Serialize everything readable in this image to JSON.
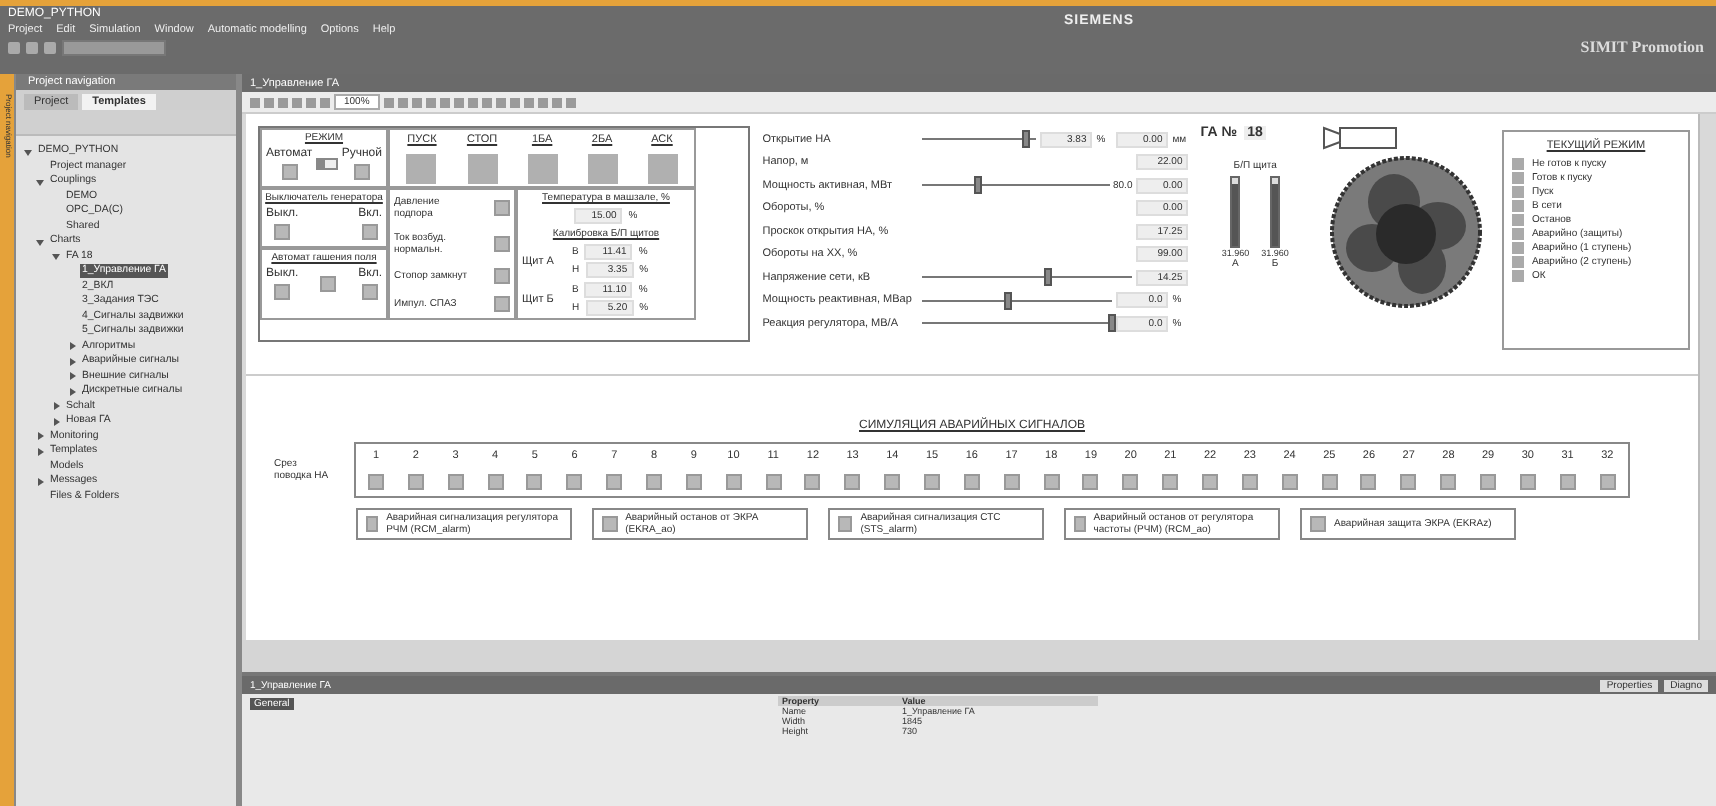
{
  "window": {
    "title": "DEMO_PYTHON",
    "brand": "SIEMENS",
    "product": "SIMIT Promotion"
  },
  "menu": [
    "Project",
    "Edit",
    "Simulation",
    "Window",
    "Automatic modelling",
    "Options",
    "Help"
  ],
  "navigator": {
    "title": "Project navigation",
    "side_label": "Project navigation",
    "tabs": [
      {
        "label": "Project",
        "selected": false
      },
      {
        "label": "Templates",
        "selected": true
      }
    ],
    "tree": [
      {
        "label": "DEMO_PYTHON",
        "selected": false,
        "expanded": true,
        "children": [
          {
            "label": "Project manager",
            "selected": false
          },
          {
            "label": "Couplings",
            "selected": false,
            "expanded": true,
            "children": [
              {
                "label": "DEMO",
                "selected": false
              },
              {
                "label": "OPC_DA(C)",
                "selected": false
              },
              {
                "label": "Shared",
                "selected": false
              }
            ]
          },
          {
            "label": "Charts",
            "selected": false,
            "expanded": true,
            "children": [
              {
                "label": "FA 18",
                "selected": false,
                "expanded": true,
                "children": [
                  {
                    "label": "1_Управление ГА",
                    "selected": true
                  },
                  {
                    "label": "2_ВКЛ",
                    "selected": false
                  },
                  {
                    "label": "3_Задания ТЭС",
                    "selected": false
                  },
                  {
                    "label": "4_Сигналы задвижки",
                    "selected": false
                  },
                  {
                    "label": "5_Сигналы задвижки",
                    "selected": false
                  },
                  {
                    "label": "Алгоритмы",
                    "selected": false,
                    "expanded": false
                  },
                  {
                    "label": "Аварийные сигналы",
                    "selected": false,
                    "expanded": false
                  },
                  {
                    "label": "Внешние сигналы",
                    "selected": false,
                    "expanded": false
                  },
                  {
                    "label": "Дискретные сигналы",
                    "selected": false,
                    "expanded": false
                  }
                ]
              },
              {
                "label": "Schalt",
                "selected": false,
                "expanded": false
              },
              {
                "label": "Новая ГА",
                "selected": false,
                "expanded": false
              }
            ]
          },
          {
            "label": "Monitoring",
            "selected": false,
            "expanded": false
          },
          {
            "label": "Templates",
            "selected": false,
            "expanded": false
          },
          {
            "label": "Models",
            "selected": false
          },
          {
            "label": "Messages",
            "selected": false,
            "expanded": false
          },
          {
            "label": "Files & Folders",
            "selected": false
          }
        ]
      }
    ]
  },
  "editor": {
    "tab": "1_Управление ГА",
    "zoom": "100%"
  },
  "mode": {
    "title": "РЕЖИМ",
    "auto": "Автомат",
    "manual": "Ручной",
    "switch_on": false
  },
  "commands": [
    "ПУСК",
    "СТОП",
    "1БА",
    "2БА",
    "АСК"
  ],
  "breaker": {
    "title": "Выключатель генератора",
    "off": "Выкл.",
    "on": "Вкл."
  },
  "field_breaker": {
    "title": "Автомат гашения поля",
    "off": "Выкл.",
    "on": "Вкл."
  },
  "signals": [
    "Давление подпора",
    "Ток возбуд. нормальн.",
    "Стопор замкнут",
    "Импул. СПАЗ"
  ],
  "temperature": {
    "title": "Температура в машзале, %",
    "value": "15.00",
    "unit": "%"
  },
  "calibration": {
    "title": "Калибровка Б/П щитов",
    "shields": [
      {
        "name": "Щит А",
        "rows": [
          {
            "label": "В",
            "value": "11.41",
            "unit": "%"
          },
          {
            "label": "Н",
            "value": "3.35",
            "unit": "%"
          }
        ]
      },
      {
        "name": "Щит Б",
        "rows": [
          {
            "label": "В",
            "value": "11.10",
            "unit": "%"
          },
          {
            "label": "Н",
            "value": "5.20",
            "unit": "%"
          }
        ]
      }
    ]
  },
  "parameters": [
    {
      "label": "Открытие НА",
      "kind": "slider",
      "level": 0.9,
      "value": "3.83",
      "unit": "%",
      "extra_value": "0.00",
      "extra_unit": "мм"
    },
    {
      "label": "Напор, м",
      "kind": "field",
      "value": "22.00"
    },
    {
      "label": "Мощность активная, МВт",
      "kind": "slider",
      "level": 0.3,
      "reading": "80.0",
      "value": "0.00"
    },
    {
      "label": "Обороты, %",
      "kind": "field",
      "value": "0.00"
    },
    {
      "label": "Проскок открытия НА, %",
      "kind": "field",
      "value": "17.25"
    },
    {
      "label": "Обороты на ХХ, %",
      "kind": "field",
      "value": "99.00"
    },
    {
      "label": "Напряжение сети, кВ",
      "kind": "slider",
      "level": 0.6,
      "value": "14.25"
    },
    {
      "label": "Мощность реактивная, МВар",
      "kind": "slider",
      "level": 0.45,
      "value": "0.0",
      "unit": "%"
    },
    {
      "label": "Реакция регулятора, МВ/А",
      "kind": "slider",
      "level": 1.0,
      "value": "0.0",
      "unit": "%"
    }
  ],
  "unit": {
    "label": "ГА №",
    "number": "18",
    "bars_title": "Б/П щита",
    "bars": [
      {
        "value": "31.960",
        "name": "А",
        "level": 0.9
      },
      {
        "value": "31.960",
        "name": "Б",
        "level": 0.9
      }
    ]
  },
  "status": {
    "title": "ТЕКУЩИЙ РЕЖИМ",
    "items": [
      "Не готов к пуску",
      "Готов к пуску",
      "Пуск",
      "В сети",
      "Останов",
      "Аварийно (защиты)",
      "Аварийно (1 ступень)",
      "Аварийно (2 ступень)",
      "ОК"
    ]
  },
  "alarms": {
    "title": "СИМУЛЯЦИЯ АВАРИЙНЫХ СИГНАЛОВ",
    "row_label": "Срез поводка НА",
    "numbers": [
      "1",
      "2",
      "3",
      "4",
      "5",
      "6",
      "7",
      "8",
      "9",
      "10",
      "11",
      "12",
      "13",
      "14",
      "15",
      "16",
      "17",
      "18",
      "19",
      "20",
      "21",
      "22",
      "23",
      "24",
      "25",
      "26",
      "27",
      "28",
      "29",
      "30",
      "31",
      "32"
    ],
    "buttons": [
      "Аварийная сигнализация регулятора РЧМ (RCM_alarm)",
      "Аварийный останов от ЭКРА (EKRA_ao)",
      "Аварийная сигнализация СТС (STS_alarm)",
      "Аварийный останов от регулятора частоты (РЧМ) (RCM_ao)",
      "Аварийная защита ЭКРА (EKRAz)"
    ]
  },
  "properties_panel": {
    "title": "1_Управление ГА",
    "tabs": [
      "Properties",
      "Diagno"
    ],
    "section": "General",
    "columns": [
      "Property",
      "Value"
    ],
    "rows": [
      [
        "Name",
        "1_Управление ГА"
      ],
      [
        "Width",
        "1845"
      ],
      [
        "Height",
        "730"
      ]
    ]
  }
}
